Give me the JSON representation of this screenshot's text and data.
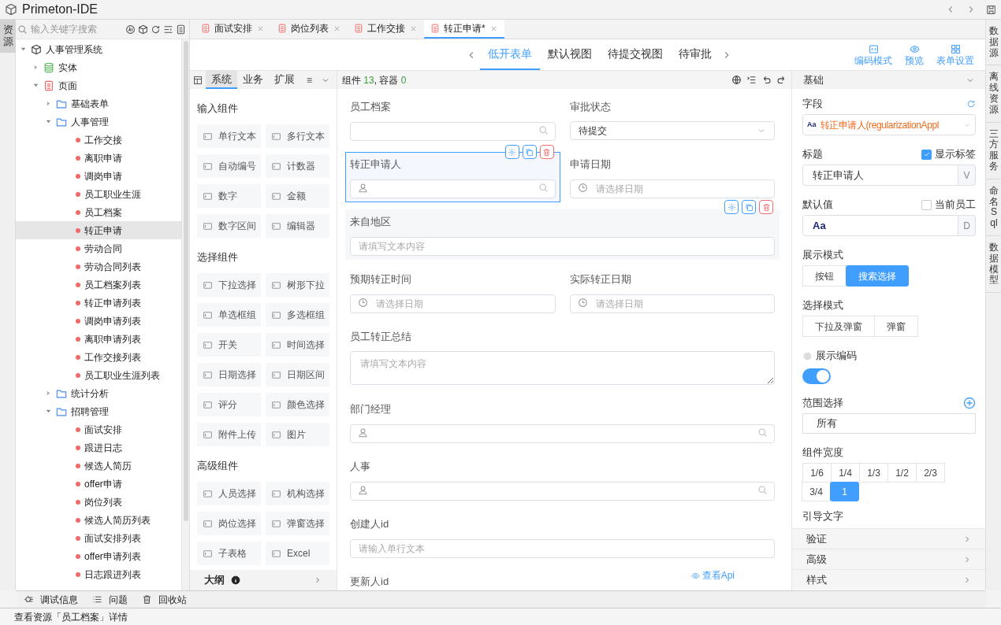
{
  "app": {
    "title": "Primeton-IDE"
  },
  "left_rail": [
    {
      "label": "资源",
      "selected": true
    }
  ],
  "resource_panel": {
    "search_placeholder": "输入关键字搜索",
    "tree": [
      {
        "label": "人事管理系统",
        "kind": "system",
        "expanded": true,
        "selected": false,
        "children": [
          {
            "label": "实体",
            "kind": "entity",
            "expanded": false,
            "selected": false
          },
          {
            "label": "页面",
            "kind": "page",
            "expanded": true,
            "selected": false,
            "children": [
              {
                "label": "基础表单",
                "kind": "folder",
                "expanded": false,
                "selected": false
              },
              {
                "label": "人事管理",
                "kind": "folder",
                "expanded": true,
                "selected": false,
                "children": [
                  {
                    "label": "工作交接",
                    "kind": "leaf",
                    "selected": false
                  },
                  {
                    "label": "离职申请",
                    "kind": "leaf",
                    "selected": false
                  },
                  {
                    "label": "调岗申请",
                    "kind": "leaf",
                    "selected": false
                  },
                  {
                    "label": "员工职业生涯",
                    "kind": "leaf",
                    "selected": false
                  },
                  {
                    "label": "员工档案",
                    "kind": "leaf",
                    "selected": false
                  },
                  {
                    "label": "转正申请",
                    "kind": "leaf",
                    "selected": true
                  },
                  {
                    "label": "劳动合同",
                    "kind": "leaf",
                    "selected": false
                  },
                  {
                    "label": "劳动合同列表",
                    "kind": "leaf",
                    "selected": false
                  },
                  {
                    "label": "员工档案列表",
                    "kind": "leaf",
                    "selected": false
                  },
                  {
                    "label": "转正申请列表",
                    "kind": "leaf",
                    "selected": false
                  },
                  {
                    "label": "调岗申请列表",
                    "kind": "leaf",
                    "selected": false
                  },
                  {
                    "label": "离职申请列表",
                    "kind": "leaf",
                    "selected": false
                  },
                  {
                    "label": "工作交接列表",
                    "kind": "leaf",
                    "selected": false
                  },
                  {
                    "label": "员工职业生涯列表",
                    "kind": "leaf",
                    "selected": false
                  }
                ]
              },
              {
                "label": "统计分析",
                "kind": "folder",
                "expanded": false,
                "selected": false
              },
              {
                "label": "招聘管理",
                "kind": "folder",
                "expanded": true,
                "selected": false,
                "children": [
                  {
                    "label": "面试安排",
                    "kind": "leaf",
                    "selected": false
                  },
                  {
                    "label": "跟进日志",
                    "kind": "leaf",
                    "selected": false
                  },
                  {
                    "label": "候选人简历",
                    "kind": "leaf",
                    "selected": false
                  },
                  {
                    "label": "offer申请",
                    "kind": "leaf",
                    "selected": false
                  },
                  {
                    "label": "岗位列表",
                    "kind": "leaf",
                    "selected": false
                  },
                  {
                    "label": "候选人简历列表",
                    "kind": "leaf",
                    "selected": false
                  },
                  {
                    "label": "面试安排列表",
                    "kind": "leaf",
                    "selected": false
                  },
                  {
                    "label": "offer申请列表",
                    "kind": "leaf",
                    "selected": false
                  },
                  {
                    "label": "日志跟进列表",
                    "kind": "leaf",
                    "selected": false
                  }
                ]
              }
            ]
          }
        ]
      }
    ]
  },
  "editor_tabs": [
    {
      "label": "面试安排",
      "selected": false
    },
    {
      "label": "岗位列表",
      "selected": false
    },
    {
      "label": "工作交接",
      "selected": false
    },
    {
      "label": "转正申请*",
      "selected": true
    }
  ],
  "view_tabs": [
    {
      "label": "低开表单",
      "selected": true
    },
    {
      "label": "默认视图",
      "selected": false
    },
    {
      "label": "待提交视图",
      "selected": false
    },
    {
      "label": "待审批",
      "selected": false
    }
  ],
  "toolbar_buttons": [
    {
      "label": "编码模式",
      "kind": "code"
    },
    {
      "label": "预览",
      "kind": "preview"
    },
    {
      "label": "表单设置",
      "kind": "settings"
    }
  ],
  "palette": {
    "tabs": [
      {
        "label": "系统",
        "selected": true
      },
      {
        "label": "业务",
        "selected": false
      },
      {
        "label": "扩展",
        "selected": false
      }
    ],
    "menu_glyph": "≡",
    "groups": [
      {
        "title": "输入组件",
        "items": [
          "单行文本",
          "多行文本",
          "自动编号",
          "计数器",
          "数字",
          "金额",
          "数字区间",
          "编辑器"
        ]
      },
      {
        "title": "选择组件",
        "items": [
          "下拉选择",
          "树形下拉",
          "单选框组",
          "多选框组",
          "开关",
          "时间选择",
          "日期选择",
          "日期区间",
          "评分",
          "颜色选择",
          "附件上传",
          "图片"
        ]
      },
      {
        "title": "高级组件",
        "items": [
          "人员选择",
          "机构选择",
          "岗位选择",
          "弹窗选择",
          "子表格",
          "Excel"
        ]
      }
    ],
    "outline": "大纲"
  },
  "canvas": {
    "summary": [
      {
        "text": "组件 ",
        "kind": "label"
      },
      {
        "text": "13",
        "kind": "count"
      },
      {
        "text": ", 容器 ",
        "kind": "label"
      },
      {
        "text": "0",
        "kind": "count"
      }
    ],
    "rows": [
      [
        {
          "label": "员工档案",
          "kind": "search",
          "selected": false,
          "hovered": false
        },
        {
          "label": "审批状态",
          "kind": "select",
          "value": "待提交",
          "selected": false,
          "hovered": false
        }
      ],
      [
        {
          "label": "转正申请人",
          "kind": "person",
          "selected": true,
          "hovered": false
        },
        {
          "label": "申请日期",
          "kind": "date",
          "placeholder": "请选择日期",
          "selected": false,
          "hovered": false
        }
      ],
      [
        {
          "label": "来自地区",
          "kind": "text",
          "placeholder": "请填写文本内容",
          "selected": false,
          "hovered": true
        }
      ],
      [
        {
          "label": "预期转正时间",
          "kind": "date",
          "placeholder": "请选择日期",
          "selected": false,
          "hovered": false
        },
        {
          "label": "实际转正日期",
          "kind": "date",
          "placeholder": "请选择日期",
          "selected": false,
          "hovered": false
        }
      ],
      [
        {
          "label": "员工转正总结",
          "kind": "textarea",
          "placeholder": "请填写文本内容",
          "selected": false,
          "hovered": false
        }
      ],
      [
        {
          "label": "部门经理",
          "kind": "person",
          "selected": false,
          "hovered": false
        }
      ],
      [
        {
          "label": "人事",
          "kind": "person",
          "selected": false,
          "hovered": false
        }
      ],
      [
        {
          "label": "创建人id",
          "kind": "text",
          "placeholder": "请输入单行文本",
          "selected": false,
          "hovered": false
        }
      ],
      [
        {
          "label": "更新人id",
          "kind": "text",
          "selected": false,
          "hovered": false
        }
      ]
    ],
    "api_link": "查看Api"
  },
  "properties": {
    "section": "基础",
    "field": {
      "label": "字段",
      "badge": "Aa",
      "value": "转正申请人(regularizationAppl"
    },
    "title": {
      "label": "标题",
      "value": "转正申请人",
      "addon": "V",
      "option": {
        "label": "显示标签",
        "checked": true
      }
    },
    "default": {
      "label": "默认值",
      "value": "Aa",
      "addon": "D",
      "option": {
        "label": "当前员工",
        "checked": false
      }
    },
    "display_mode": {
      "label": "展示模式",
      "options": [
        {
          "label": "按钮",
          "selected": false
        },
        {
          "label": "搜索选择",
          "selected": true
        }
      ]
    },
    "select_mode": {
      "label": "选择模式",
      "options": [
        {
          "label": "下拉及弹窗",
          "selected": false
        },
        {
          "label": "弹窗",
          "selected": false
        }
      ]
    },
    "show_code": {
      "label": "展示编码",
      "on": true
    },
    "scope": {
      "label": "范围选择",
      "value": "所有"
    },
    "width": {
      "label": "组件宽度",
      "options": [
        {
          "label": "1/6",
          "selected": false
        },
        {
          "label": "1/4",
          "selected": false
        },
        {
          "label": "1/3",
          "selected": false
        },
        {
          "label": "1/2",
          "selected": false
        },
        {
          "label": "2/3",
          "selected": false
        },
        {
          "label": "3/4",
          "selected": false
        },
        {
          "label": "1",
          "selected": true
        }
      ]
    },
    "hint": {
      "label": "引导文字"
    },
    "sections": [
      "验证",
      "高级",
      "样式"
    ]
  },
  "right_rail": [
    {
      "label": "数据源"
    },
    {
      "label": "离线资源"
    },
    {
      "label": "三方服务"
    },
    {
      "label": "命名Sql"
    },
    {
      "label": "数据模型"
    }
  ],
  "bottom_tools": [
    {
      "label": "调试信息",
      "kind": "debug"
    },
    {
      "label": "问题",
      "kind": "list"
    },
    {
      "label": "回收站",
      "kind": "trash"
    }
  ],
  "status_bar": "查看资源「员工档案」详情"
}
